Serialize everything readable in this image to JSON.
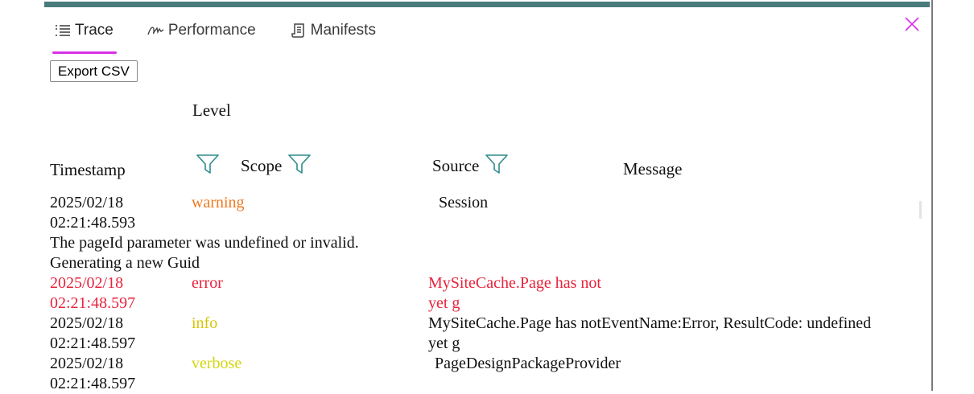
{
  "tabs": [
    {
      "label": "Trace",
      "icon": "list-icon",
      "active": true
    },
    {
      "label": "Performance",
      "icon": "signature-icon",
      "active": false
    },
    {
      "label": "Manifests",
      "icon": "document-icon",
      "active": false
    }
  ],
  "toolbar": {
    "export_label": "Export CSV"
  },
  "columns": {
    "timestamp": "Timestamp",
    "level": "Level",
    "scope": "Scope",
    "source": "Source",
    "message": "Message"
  },
  "colors": {
    "accent": "#d631e8",
    "topbar": "#4a7b7b",
    "warning": "#f07a22",
    "error": "#e8233c",
    "info": "#d8c40a",
    "verbose": "#d5d511"
  },
  "rows": [
    {
      "timestamp_date": "2025/02/18",
      "timestamp_time": "02:21:48.593",
      "level": "warning",
      "source": "Session",
      "message_line1": "The pageId parameter was undefined or invalid.",
      "message_line2": "Generating a new Guid"
    },
    {
      "timestamp_date": "2025/02/18",
      "timestamp_time": "02:21:48.597",
      "level": "error",
      "source_line1": "MySiteCache.Page has not",
      "source_line2": "yet g"
    },
    {
      "timestamp_date": "2025/02/18",
      "timestamp_time": "02:21:48.597",
      "level": "info",
      "source_line1": "MySiteCache.Page has notEventName:Error, ResultCode: undefined",
      "source_line2": "yet g"
    },
    {
      "timestamp_date": "2025/02/18",
      "timestamp_time": "02:21:48.597",
      "level": "verbose",
      "source": "PageDesignPackageProvider"
    }
  ]
}
